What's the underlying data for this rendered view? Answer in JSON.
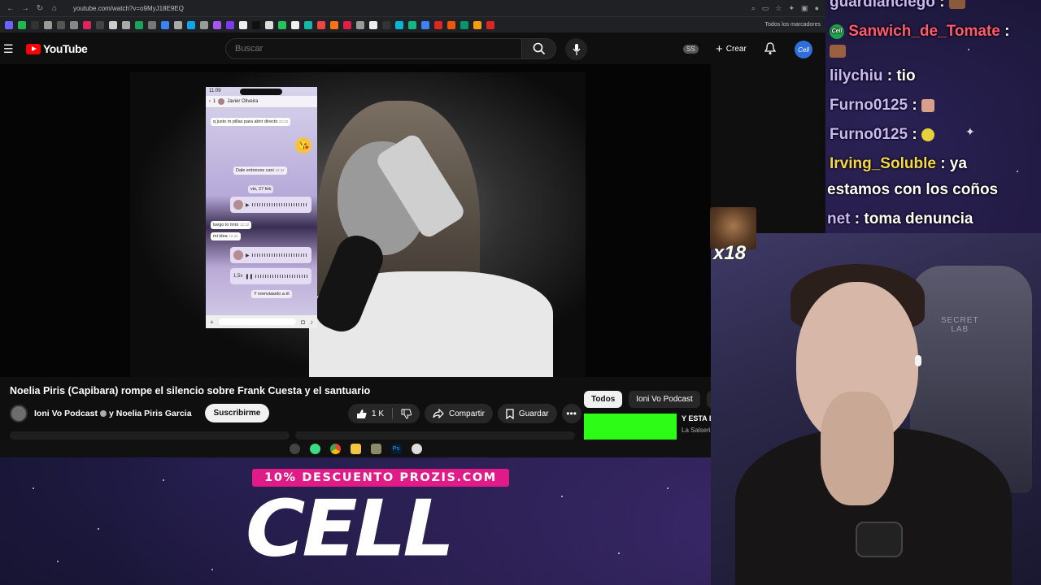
{
  "browser": {
    "url": "youtube.com/watch?v=o9MyJ18E9EQ",
    "bookmarks_folder": "Todos los marcadores"
  },
  "youtube": {
    "logo_text": "YouTube",
    "search_placeholder": "Buscar",
    "ss_badge": "SS",
    "create_label": "Crear",
    "avatar_text": "Cell"
  },
  "chat_overlay": {
    "time": "11:09",
    "back_count": "1",
    "contact": "Javier Oliveira",
    "msg1": "q justo m pillas para abrir directo",
    "msg1_time": "22:42",
    "msg2": "Dale entonces cani",
    "msg2_time": "22:42",
    "date_pill": "vie, 27 feb",
    "msg3": "luego lo miro",
    "msg3_time": "12:32",
    "msg4": "mi idea",
    "msg4_time": "12:32",
    "voice_speed": "1,5x",
    "msg5": "Y reenviaselo a él",
    "emoji": "😘"
  },
  "video": {
    "title": "Noelia Piris (Capibara) rompe el silencio sobre Frank Cuesta y el santuario",
    "channel": "Ioni Vo Podcast",
    "collab": "y Noelia Piris Garcia",
    "subscribe": "Suscribirme",
    "likes": "1 K",
    "share": "Compartir",
    "save": "Guardar",
    "more": "•••"
  },
  "sidebar": {
    "chips": [
      "Todos",
      "Ioni Vo Podcast",
      "Pó"
    ],
    "rec_title": "Y ESTA L",
    "rec_channel": "La Salseri"
  },
  "stream_chat": {
    "lines": [
      {
        "user": "guardianciego",
        "sep": " :",
        "msg": ""
      },
      {
        "user": "Sanwich_de_Tomate",
        "sep": " :",
        "msg": ""
      },
      {
        "user": "lilychiu",
        "sep": " :",
        "msg": " tio"
      },
      {
        "user": "Furno0125",
        "sep": " :",
        "msg": ""
      },
      {
        "user": "Furno0125",
        "sep": " :",
        "msg": ""
      },
      {
        "user": "Irving_Soluble",
        "sep": " :",
        "msg": " ya"
      },
      {
        "user": "",
        "sep": "",
        "msg": "estamos con los coños"
      },
      {
        "user": "net",
        "sep": " :",
        "msg": " toma denuncia"
      }
    ],
    "badge_text": "Cell"
  },
  "overlay": {
    "x18": "x18",
    "chair_text": "SECRET\nLAB"
  },
  "promo": {
    "tag": "10% DESCUENTO PROZIS.COM",
    "big": "CELL"
  },
  "colors": {
    "yt_red": "#ff0000",
    "promo_pink": "#e01a86",
    "chat_user_purple": "#c8b8f5",
    "chat_user_red": "#ff5a6e",
    "chat_user_yellow": "#f5d84a",
    "rec_thumb_green": "#2dfc16"
  }
}
